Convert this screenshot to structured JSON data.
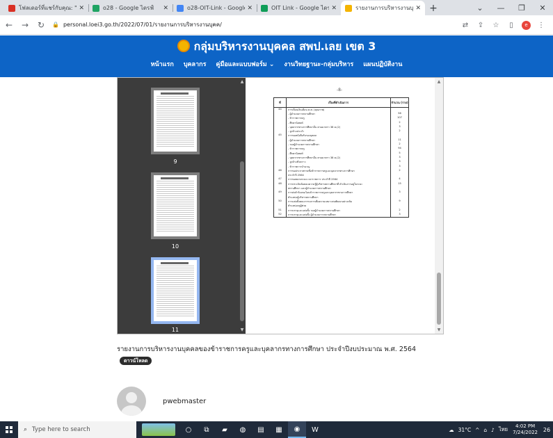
{
  "browser": {
    "tabs": [
      {
        "title": "โฟลเดอร์ที่แชร์กับคุณ: \"o28\"",
        "color": "#d93025",
        "active": false
      },
      {
        "title": "o28 - Google ไดรฟ์",
        "color": "#1fa463",
        "active": false
      },
      {
        "title": "o28-OIT-Link - Google ชี",
        "color": "#4285f4",
        "active": false
      },
      {
        "title": "OIT Link - Google ไดรฟ์",
        "color": "#0f9d58",
        "active": false
      },
      {
        "title": "รายงานการบริหารงานบุคคลฯ",
        "color": "#f4b400",
        "active": true
      }
    ],
    "url": "personal.loei3.go.th/2022/07/01/รายงานการบริหารงานบุคค/",
    "profile_initial": "e"
  },
  "site": {
    "title": "กลุ่มบริหารงานบุคคล สพป.เลย เขต 3",
    "nav": [
      "หน้าแรก",
      "บุคลากร",
      "คู่มือและแบบฟอร์ม ⌄",
      "งานวิทยฐานะ-กลุ่มบริหาร",
      "แผนปฏิบัติงาน"
    ]
  },
  "pdf": {
    "thumbnails": [
      {
        "label": "9",
        "selected": false
      },
      {
        "label": "10",
        "selected": false
      },
      {
        "label": "11",
        "selected": true
      }
    ],
    "page_number": "-8-",
    "table": {
      "headers": [
        "ที่",
        "เรื่องที่ดำเนินการ",
        "จำนวน (ราย)"
      ],
      "rows": [
        [
          "44",
          "การเลื่อนเงินเดือน ค.ศ. (คุณภาพ)",
          ""
        ],
        [
          "",
          "- ผู้อำนวยการสถานศึกษา",
          "56"
        ],
        [
          "",
          "- ข้าราชการครู",
          "107"
        ],
        [
          "",
          "- ศึกษานิเทศก์",
          "2"
        ],
        [
          "",
          "- บุคลากรทางการศึกษาอื่น ตามมาตรา 38 ค.(2)",
          "3"
        ],
        [
          "",
          "- ลูกจ้างประจำ",
          "2"
        ],
        [
          "45",
          "การขอหนังสือรับรองบุคคล",
          ""
        ],
        [
          "",
          "- ผู้อำนวยการสถานศึกษา",
          "11"
        ],
        [
          "",
          "- รองผู้อำนวยการสถานศึกษา",
          "2"
        ],
        [
          "",
          "- ข้าราชการครู",
          "94"
        ],
        [
          "",
          "- ศึกษานิเทศก์",
          "5"
        ],
        [
          "",
          "- บุคลากรทางการศึกษาอื่น ตามมาตรา 38 ค.(2)",
          "3"
        ],
        [
          "",
          "- ลูกจ้างชั่วคราว",
          "3"
        ],
        [
          "",
          "- ข้าราชการบำนาญ",
          "3"
        ],
        [
          "46",
          "การขอประกาศรายชื่อข้าราชการครูและบุคลากรทางการศึกษา",
          "2"
        ],
        [
          "",
          "ประจำปี 2564",
          ""
        ],
        [
          "47",
          "การขอขยายระยะเวลาราชการ ประจำปี 2564",
          "4"
        ],
        [
          "48",
          "การประเมินข้อสอบความรู้ผู้บริหารสถานศึกษาที่ ดำเนินการอยู่ในระยะ",
          "15"
        ],
        [
          "",
          "สถานศึกษา และผู้อำนวยการสถานศึกษา",
          ""
        ],
        [
          "49",
          "การส่งคำร้องขอโอนข้าราชการครูและบุคลากรทางการศึกษา",
          "3"
        ],
        [
          "",
          "ตำแหน่งผู้บริหารสถานศึกษา",
          ""
        ],
        [
          "50",
          "การแต่งตั้งคณะกรรมการเพื่อความเหมาะสมพัฒนาอย่างเข้ม",
          "9"
        ],
        [
          "",
          "ตำแหน่งครูผู้ช่วย",
          ""
        ],
        [
          "51",
          "การบรรจุและแต่งตั้ง รองผู้อำนวยการสถานศึกษา",
          "2"
        ],
        [
          "52",
          "การบรรจุและแต่งตั้ง ผู้อำนวยการสถานศึกษา",
          "3"
        ]
      ]
    }
  },
  "post": {
    "caption": "รายงานการบริหารงานบุคคลของข้าราชการครูและบุคลากรทางการศึกษา ประจำปีงบประมาณ พ.ศ. 2564",
    "download_label": "ดาวน์โหลด",
    "author": "pwebmaster"
  },
  "taskbar": {
    "search_placeholder": "Type here to search",
    "temperature": "31°C",
    "language": "ไทย",
    "time": "4:02 PM",
    "date": "7/24/2022",
    "notifications": "26"
  }
}
